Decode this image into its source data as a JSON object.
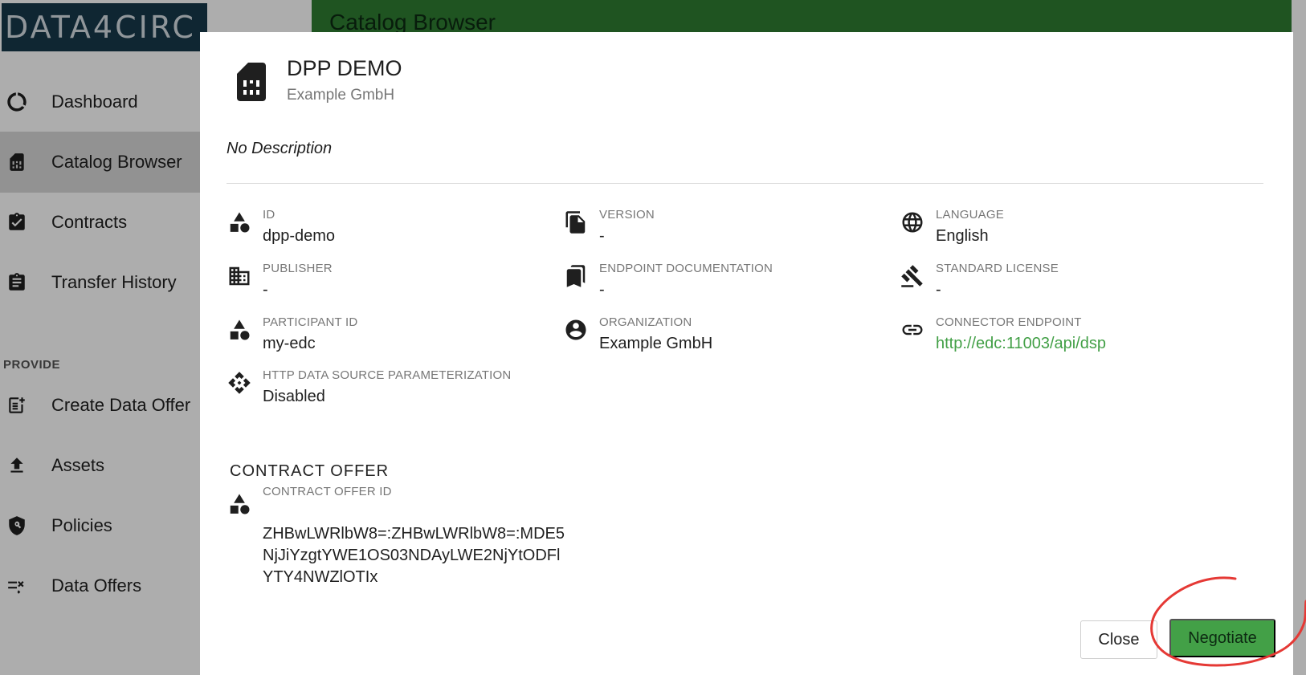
{
  "app": {
    "logo_text": "DATA4CIRC",
    "page_title": "Catalog Browser"
  },
  "sidebar": {
    "items": [
      {
        "label": "Dashboard",
        "icon": "dashboard-icon"
      },
      {
        "label": "Catalog Browser",
        "icon": "catalog-icon",
        "active": true
      },
      {
        "label": "Contracts",
        "icon": "contracts-icon"
      },
      {
        "label": "Transfer History",
        "icon": "transfer-history-icon"
      }
    ],
    "section_provide": "PROVIDE",
    "provide_items": [
      {
        "label": "Create Data Offer",
        "icon": "create-data-offer-icon"
      },
      {
        "label": "Assets",
        "icon": "upload-icon"
      },
      {
        "label": "Policies",
        "icon": "policy-shield-icon"
      },
      {
        "label": "Data Offers",
        "icon": "data-offers-icon"
      }
    ]
  },
  "dialog": {
    "title": "DPP DEMO",
    "subtitle": "Example GmbH",
    "description": "No Description",
    "properties": {
      "id": {
        "label": "ID",
        "value": "dpp-demo"
      },
      "version": {
        "label": "VERSION",
        "value": "-"
      },
      "language": {
        "label": "LANGUAGE",
        "value": "English"
      },
      "publisher": {
        "label": "PUBLISHER",
        "value": "-"
      },
      "endpoint_documentation": {
        "label": "ENDPOINT DOCUMENTATION",
        "value": "-"
      },
      "standard_license": {
        "label": "STANDARD LICENSE",
        "value": "-"
      },
      "participant_id": {
        "label": "PARTICIPANT ID",
        "value": "my-edc"
      },
      "organization": {
        "label": "ORGANIZATION",
        "value": "Example GmbH"
      },
      "connector_endpoint": {
        "label": "CONNECTOR ENDPOINT",
        "value": "http://edc:11003/api/dsp"
      },
      "http_data_source": {
        "label": "HTTP DATA SOURCE PARAMETERIZATION",
        "value": "Disabled"
      }
    },
    "contract_offer_section": "CONTRACT OFFER",
    "contract_offer_id": {
      "label": "CONTRACT OFFER ID",
      "value": "ZHBwLWRlbW8=:ZHBwLWRlbW8=:MDE5NjJiYzgtYWE1OS03NDAyLWE2NjYtODFlYTY4NWZlOTIx"
    },
    "buttons": {
      "close": "Close",
      "negotiate": "Negotiate"
    }
  },
  "colors": {
    "brand_green": "#43a047",
    "topbar_green": "#2e7d32",
    "logo_bg": "#17384a",
    "annotation_red": "#e53935"
  }
}
